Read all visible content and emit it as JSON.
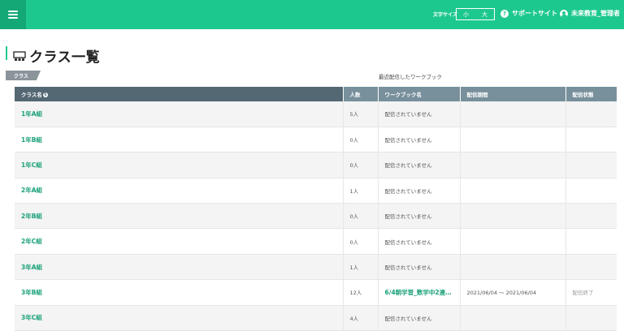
{
  "header": {
    "font_size_label": "文字サイズ",
    "font_size_options": [
      "小",
      "大"
    ],
    "support_label": "サポートサイト",
    "user_name": "未来教育_管理者"
  },
  "page": {
    "title": "クラス一覧",
    "class_tag": "クラス",
    "recent_label": "最近配信したワークブック"
  },
  "table": {
    "headers": [
      "クラス名",
      "人数",
      "ワークブック名",
      "配信期間",
      "配信状態"
    ],
    "rows": [
      {
        "class": "1年A組",
        "count": "5人",
        "workbook": "配信されていません",
        "period": "",
        "status": ""
      },
      {
        "class": "1年B組",
        "count": "0人",
        "workbook": "配信されていません",
        "period": "",
        "status": ""
      },
      {
        "class": "1年C組",
        "count": "0人",
        "workbook": "配信されていません",
        "period": "",
        "status": ""
      },
      {
        "class": "2年A組",
        "count": "1人",
        "workbook": "配信されていません",
        "period": "",
        "status": ""
      },
      {
        "class": "2年B組",
        "count": "0人",
        "workbook": "配信されていません",
        "period": "",
        "status": ""
      },
      {
        "class": "2年C組",
        "count": "0人",
        "workbook": "配信されていません",
        "period": "",
        "status": ""
      },
      {
        "class": "3年A組",
        "count": "1人",
        "workbook": "配信されていません",
        "period": "",
        "status": ""
      },
      {
        "class": "3年B組",
        "count": "12人",
        "workbook": "6/4朝学習_数学中2連…",
        "period": "2021/06/04 〜 2021/06/04",
        "status": "配信終了"
      },
      {
        "class": "3年C組",
        "count": "4人",
        "workbook": "配信されていません",
        "period": "",
        "status": ""
      }
    ]
  },
  "colors": {
    "accent": "#1dc88e",
    "header_dark": "#546874",
    "header": "#78909c",
    "link": "#1ba17a"
  }
}
